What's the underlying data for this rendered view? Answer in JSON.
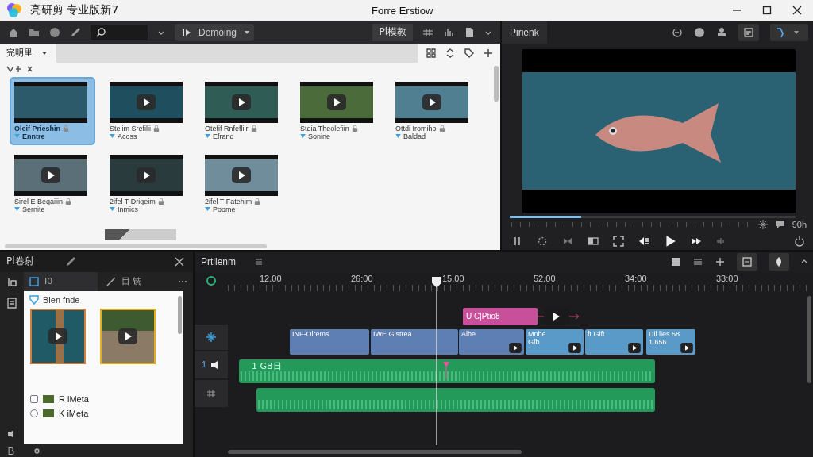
{
  "window": {
    "app_name": "亮研剪 专业版新7",
    "title": "Forre Erstiow"
  },
  "toolbar": {
    "project": "Demoing",
    "tab": "Pl模教"
  },
  "media": {
    "title": "完明里",
    "clips": [
      {
        "kind": "full",
        "name": "Oleif Prieshin",
        "tag": "Enntre",
        "selected": true
      },
      {
        "kind": "full",
        "name": "Stelim Srefilii",
        "tag": "Acoss",
        "selected": false
      },
      {
        "kind": "full",
        "name": "Otefif Rnfefliir",
        "tag": "Efrand",
        "selected": false
      },
      {
        "kind": "full",
        "name": "Stdia Theolefiin",
        "tag": "Sonine",
        "selected": false
      },
      {
        "kind": "full",
        "name": "Ottdi Iromiho",
        "tag": "Baldad",
        "selected": false
      },
      {
        "kind": "full",
        "name": "Sirel E Beqaiiin",
        "tag": "Sernite",
        "selected": false
      },
      {
        "kind": "full",
        "name": "2ifel T Drigeim",
        "tag": "Inmics",
        "selected": false
      },
      {
        "kind": "full",
        "name": "2ifel T Fatehim",
        "tag": "Poome",
        "selected": false
      },
      {
        "kind": "partial"
      }
    ]
  },
  "preview": {
    "title": "Pirienk",
    "level": 0.25,
    "timecode": "90h"
  },
  "panel": {
    "title": "Pl卷射",
    "subtabs": [
      {
        "label": "I0",
        "selected": true
      },
      {
        "label": "目 铣",
        "selected": false
      }
    ],
    "folder": "Bien fnde",
    "items": [
      {
        "name": "R iMeta",
        "checked": false
      },
      {
        "name": "K iMeta",
        "checked": false
      }
    ]
  },
  "timeline": {
    "title": "Prtilenm",
    "ruler": [
      "12.00",
      "26:00",
      "15.00",
      "52.00",
      "34:00",
      "33:00"
    ],
    "title_clip": "U C|Ptio8",
    "video_clips": [
      {
        "label": "INF-Olrems"
      },
      {
        "label": "IWE Gistrea"
      },
      {
        "label": "Albe"
      },
      {
        "label": "Mnhe",
        "sub": "Gfb"
      },
      {
        "label": "ft Gift"
      },
      {
        "label": "Dil lies 58",
        "sub": "1.656"
      }
    ],
    "audio_label": "1 GB日",
    "track_number": "1"
  }
}
